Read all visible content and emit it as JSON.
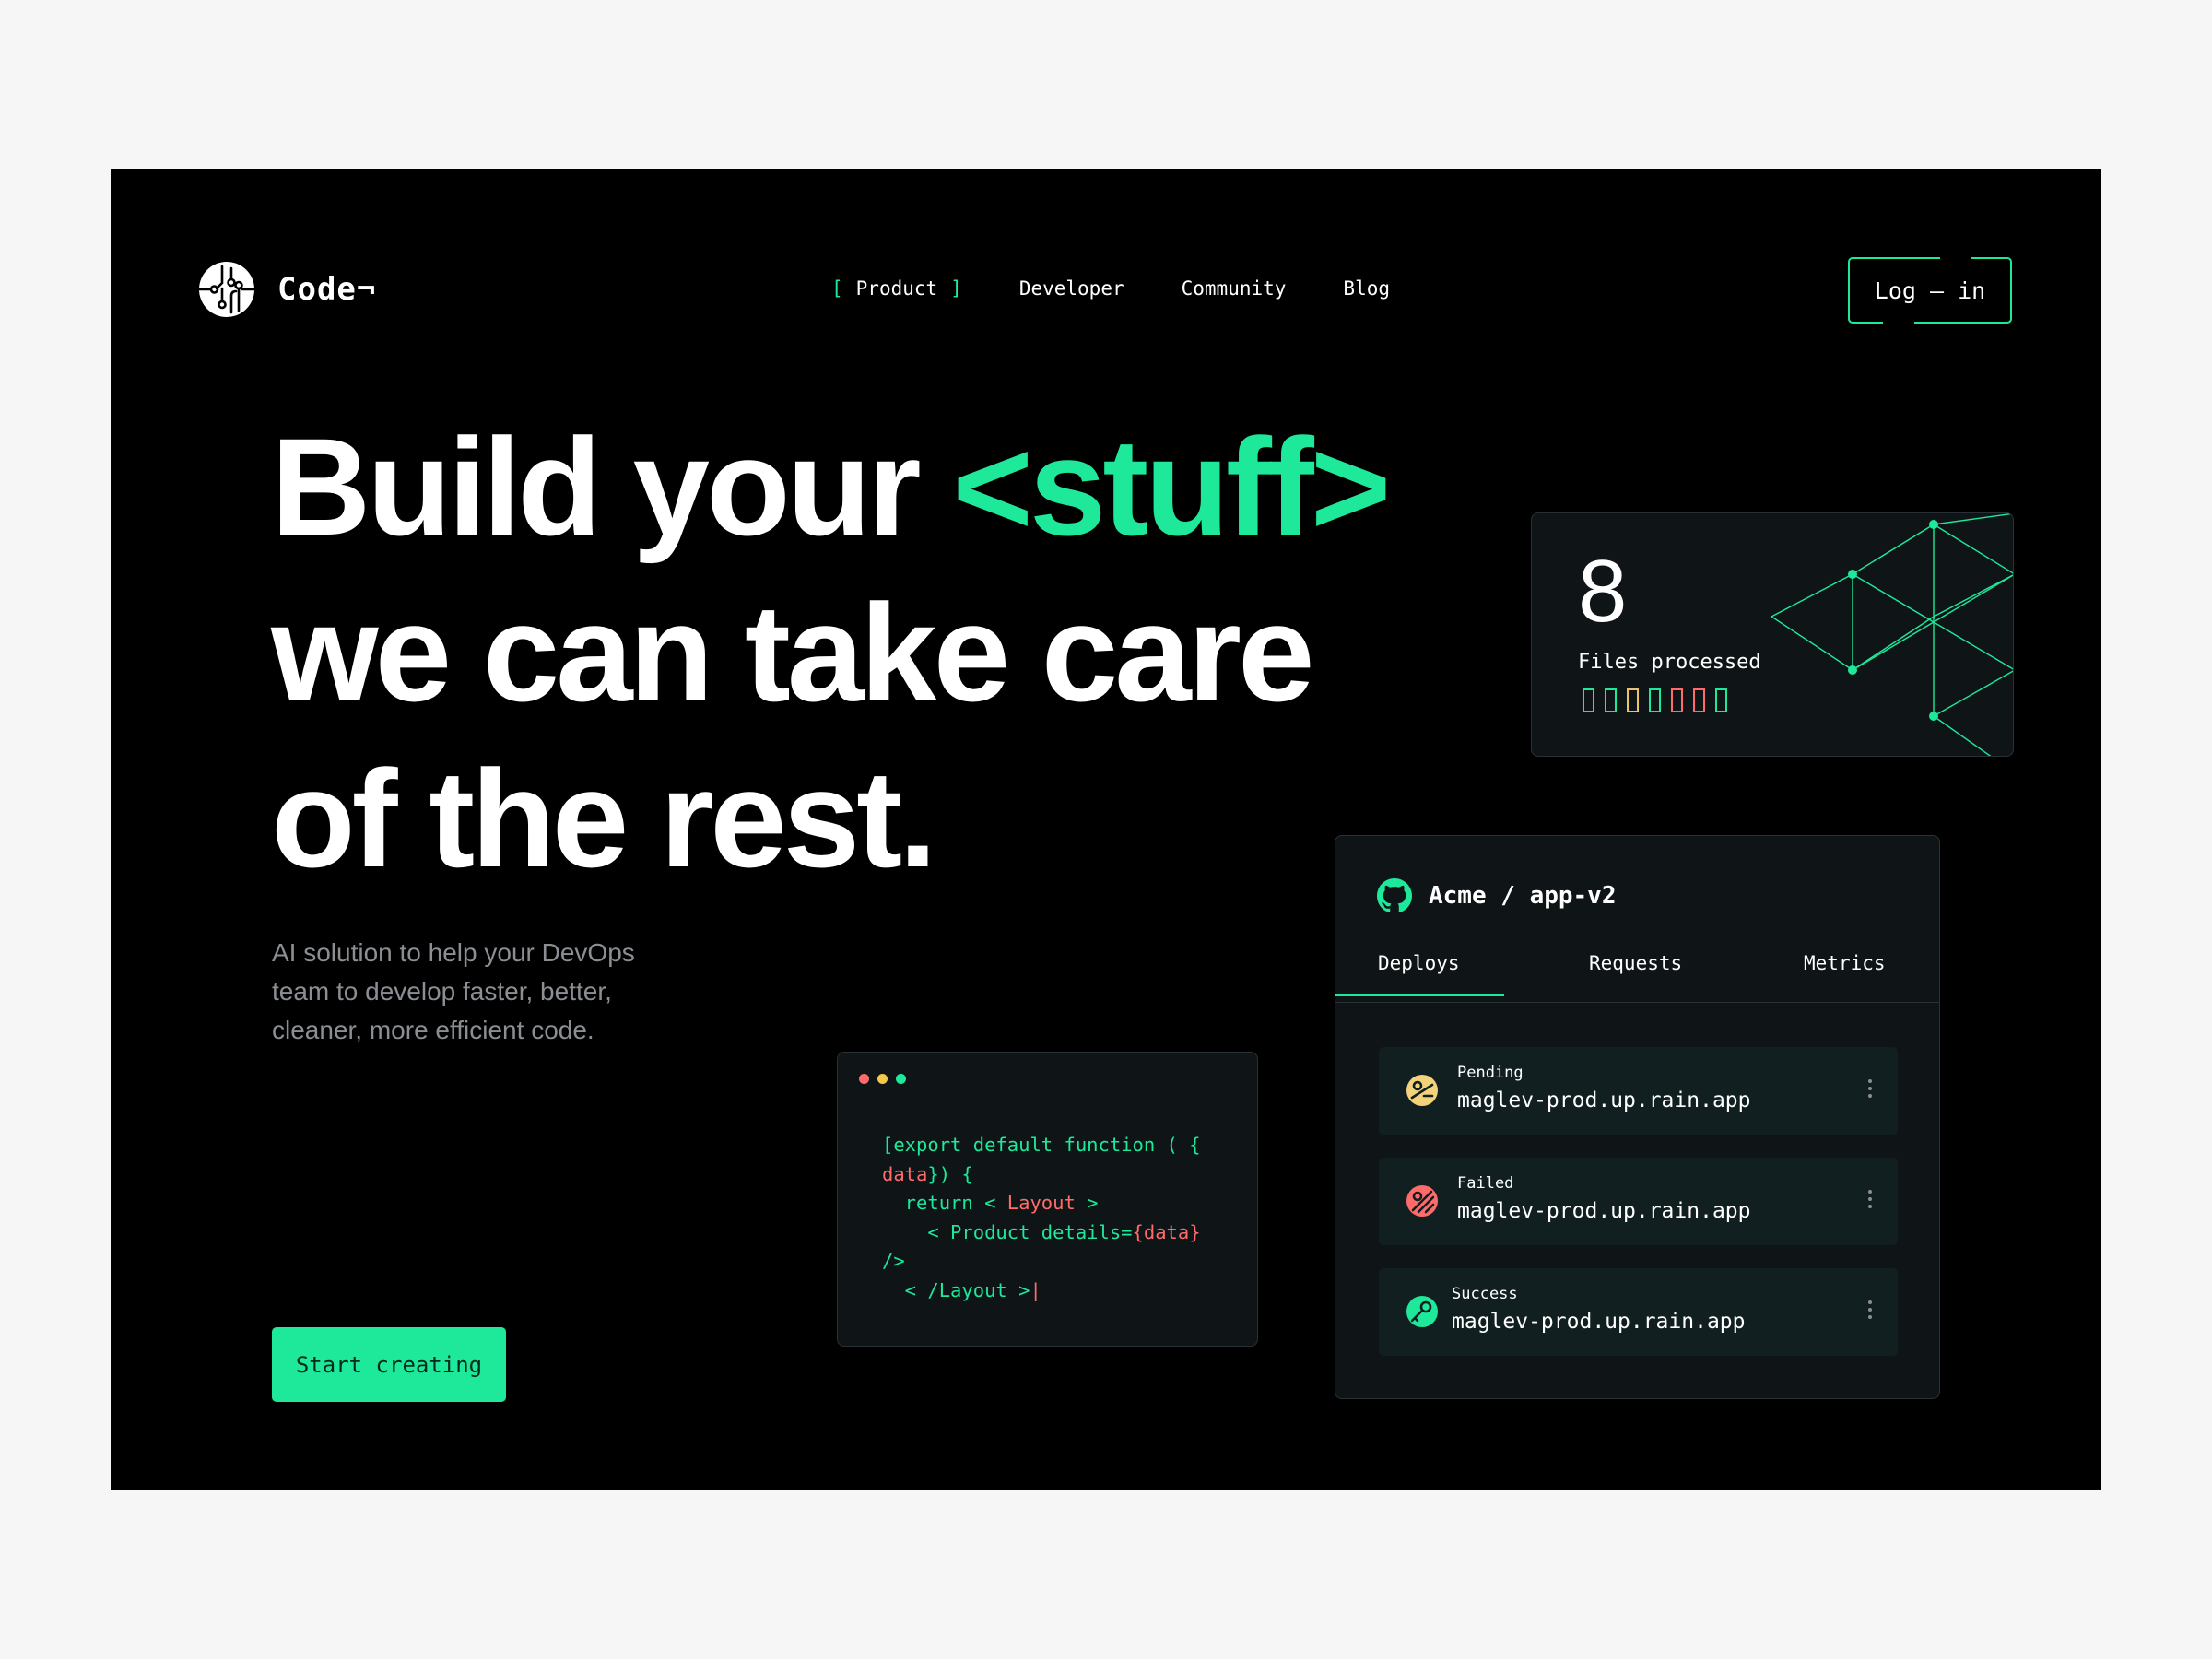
{
  "brand": {
    "name": "Code¬",
    "logo_icon": "circuit-logo-icon"
  },
  "nav": {
    "items": [
      {
        "label": "Product",
        "active": true
      },
      {
        "label": "Developer"
      },
      {
        "label": "Community"
      },
      {
        "label": "Blog"
      }
    ],
    "active_bracket_left": "[",
    "active_bracket_right": "]",
    "login_label": "Log – in"
  },
  "hero": {
    "line1_a": "Build your ",
    "line1_b": "<stuff>",
    "line2": "we can take care",
    "line3": "of the rest.",
    "subtitle": "AI solution to help your DevOps team to develop faster, better, cleaner, more efficient code.",
    "cta_label": "Start creating"
  },
  "files_card": {
    "count": "8",
    "label": "Files processed",
    "bar_colors": [
      "#1ee99a",
      "#1ee99a",
      "#e9c46a",
      "#1ee99a",
      "#ff6b6b",
      "#ff6b6b",
      "#1ee99a"
    ]
  },
  "code_card": {
    "dot_colors": [
      "#ff6b6b",
      "#f4c84a",
      "#1ee99a"
    ],
    "l1": "[export default function ( {",
    "l2a": "data",
    "l2b": "}) {",
    "l3a": "  return < ",
    "l3b": "Layout",
    "l3c": " >",
    "l4a": "    < Product details=",
    "l4b": "{",
    "l4c": "data",
    "l4d": "}",
    "l5": "/>",
    "l6a": "  < /Layout >",
    "l6b": "|"
  },
  "repo_card": {
    "title": "Acme  /  app-v2",
    "icon": "github-icon",
    "tabs": [
      {
        "label": "Deploys",
        "active": true
      },
      {
        "label": "Requests"
      },
      {
        "label": "Metrics"
      }
    ],
    "deploys": [
      {
        "status": "Pending",
        "host": "maglev-prod.up.rain.app",
        "color": "#f4d27a",
        "icon": "pending-icon"
      },
      {
        "status": "Failed",
        "host": "maglev-prod.up.rain.app",
        "color": "#ff6b6b",
        "icon": "failed-icon"
      },
      {
        "status": "Success",
        "host": "maglev-prod.up.rain.app",
        "color": "#1ee99a",
        "icon": "success-icon"
      }
    ]
  },
  "colors": {
    "accent": "#1ee99a",
    "background": "#000000",
    "card": "#0f1417",
    "muted": "#8b8f93"
  }
}
